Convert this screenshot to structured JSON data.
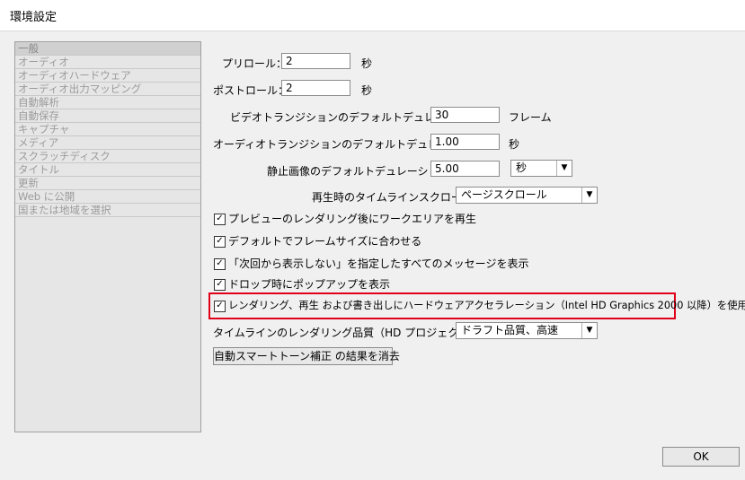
{
  "window": {
    "title": "環境設定"
  },
  "sidebar": {
    "items": [
      {
        "label": "一般"
      },
      {
        "label": "オーディオ"
      },
      {
        "label": "オーディオハードウェア"
      },
      {
        "label": "オーディオ出力マッピング"
      },
      {
        "label": "自動解析"
      },
      {
        "label": "自動保存"
      },
      {
        "label": "キャプチャ"
      },
      {
        "label": "メディア"
      },
      {
        "label": "スクラッチディスク"
      },
      {
        "label": "タイトル"
      },
      {
        "label": "更新"
      },
      {
        "label": "Web に公開"
      },
      {
        "label": "国または地域を選択"
      }
    ]
  },
  "general": {
    "preroll_label": "プリロール：",
    "preroll_value": "2",
    "preroll_unit": "秒",
    "postroll_label": "ポストロール：",
    "postroll_value": "2",
    "postroll_unit": "秒",
    "video_transition_label": "ビデオトランジションのデフォルトデュレーション：",
    "video_transition_value": "30",
    "video_transition_unit": "フレーム",
    "audio_transition_label": "オーディオトランジションのデフォルトデュレーション：",
    "audio_transition_value": "1.00",
    "audio_transition_unit": "秒",
    "still_image_label": "静止画像のデフォルトデュレーション：",
    "still_image_value": "5.00",
    "still_image_unit_selected": "秒",
    "timeline_scroll_label": "再生時のタイムラインスクロール：",
    "timeline_scroll_selected": "ページスクロール",
    "checkboxes": [
      {
        "label": "プレビューのレンダリング後にワークエリアを再生",
        "checked": true
      },
      {
        "label": "デフォルトでフレームサイズに合わせる",
        "checked": true
      },
      {
        "label": "「次回から表示しない」を指定したすべてのメッセージを表示",
        "checked": true
      },
      {
        "label": "ドロップ時にポップアップを表示",
        "checked": true
      },
      {
        "label": "レンダリング、再生 および書き出しにハードウェアアクセラレーション（Intel HD Graphics 2000 以降）を使用",
        "checked": true
      }
    ],
    "quality_label": "タイムラインのレンダリング品質（HD プロジェクトで有効）：",
    "quality_selected": "ドラフト品質、高速",
    "clear_button_label": "自動スマートトーン補正 の結果を消去"
  },
  "footer": {
    "ok_label": "OK"
  },
  "colors": {
    "highlight": "#e0001a"
  }
}
